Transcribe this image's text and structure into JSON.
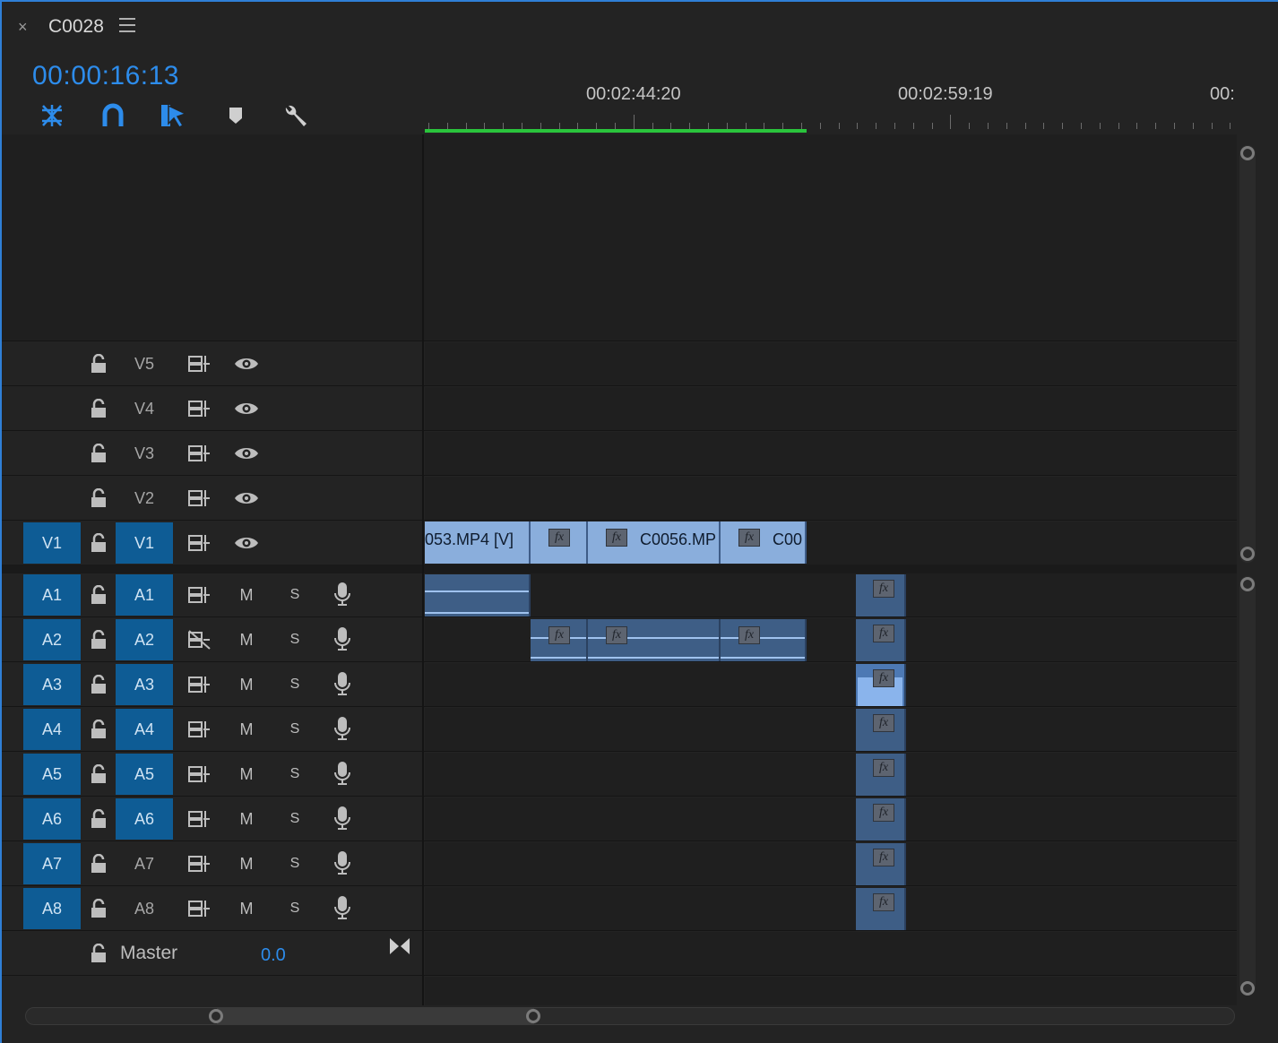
{
  "window": {
    "title": "C0028",
    "close_glyph": "×"
  },
  "timecode": "00:00:16:13",
  "toolbar": {
    "tools": [
      "insert-nest-icon",
      "snap-magnet-icon",
      "linked-selection-icon",
      "add-marker-icon",
      "wrench-settings-icon"
    ]
  },
  "ruler": {
    "labels": [
      "00:02:44:20",
      "00:02:59:19",
      "00:"
    ]
  },
  "video_tracks": [
    {
      "name": "V5",
      "source": "",
      "targeted": false
    },
    {
      "name": "V4",
      "source": "",
      "targeted": false
    },
    {
      "name": "V3",
      "source": "",
      "targeted": false
    },
    {
      "name": "V2",
      "source": "",
      "targeted": false
    },
    {
      "name": "V1",
      "source": "V1",
      "targeted": true
    }
  ],
  "audio_tracks": [
    {
      "name": "A1",
      "source": "A1",
      "targeted": true
    },
    {
      "name": "A2",
      "source": "A2",
      "targeted": true
    },
    {
      "name": "A3",
      "source": "A3",
      "targeted": true
    },
    {
      "name": "A4",
      "source": "A4",
      "targeted": true
    },
    {
      "name": "A5",
      "source": "A5",
      "targeted": true
    },
    {
      "name": "A6",
      "source": "A6",
      "targeted": true
    },
    {
      "name": "A7",
      "source": "A7",
      "targeted": false
    },
    {
      "name": "A8",
      "source": "A8",
      "targeted": false
    }
  ],
  "audio_buttons": {
    "mute": "M",
    "solo": "S"
  },
  "master": {
    "label": "Master",
    "value": "0.0"
  },
  "clips": {
    "v1": [
      "053.MP4 [V]",
      "",
      "C0056.MP",
      "C00"
    ],
    "fx_label": "fx"
  }
}
